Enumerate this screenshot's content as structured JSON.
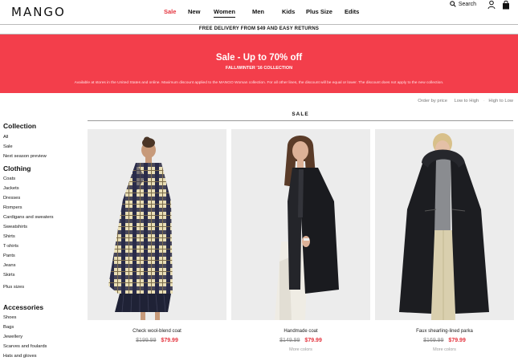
{
  "header": {
    "logo": "MANGO",
    "nav": [
      {
        "label": "Sale",
        "key": "sale"
      },
      {
        "label": "New",
        "key": "new"
      },
      {
        "label": "Women",
        "key": "women"
      },
      {
        "label": "Men",
        "key": "men"
      },
      {
        "label": "Kids",
        "key": "kids"
      },
      {
        "label": "Plus Size",
        "key": "plus-size"
      },
      {
        "label": "Edits",
        "key": "edits"
      }
    ],
    "search_label": "Search"
  },
  "delivery_text": "FREE DELIVERY FROM $49 AND EASY RETURNS",
  "promo": {
    "title": "Sale - Up to 70% off",
    "subtitle": "FALL/WINTER '16 COLLECTION",
    "note": "Available at stores in the United States and online. Maximum discount applied to the MANGO Woman collection. For all other lines, the discount will be equal or lower. The discount does not apply to the new collection.",
    "color": "#f33e4b"
  },
  "order_by": {
    "label": "Order by price",
    "options": [
      "Low to High",
      "High to Low"
    ]
  },
  "section_title": "SALE",
  "sidebar": {
    "collection_heading": "Collection",
    "collection": [
      "All",
      "Sale",
      "Next season preview"
    ],
    "clothing_heading": "Clothing",
    "clothing": [
      "Coats",
      "Jackets",
      "Dresses",
      "Rompers",
      "Cardigans and sweaters",
      "Sweatshirts",
      "Shirts",
      "T-shirts",
      "Pants",
      "Jeans",
      "Skirts"
    ],
    "plus_sizes": "Plus sizes",
    "accessories_heading": "Accessories",
    "accessories": [
      "Shoes",
      "Bags",
      "Jewellery",
      "Scarves and foulards",
      "Hats and gloves"
    ]
  },
  "products": [
    {
      "name": "Check wool-blend coat",
      "old_price": "$199.99",
      "new_price": "$79.99",
      "more": ""
    },
    {
      "name": "Handmade coat",
      "old_price": "$149.99",
      "new_price": "$79.99",
      "more": "More colors"
    },
    {
      "name": "Faux shearling-lined parka",
      "old_price": "$169.99",
      "new_price": "$79.99",
      "more": "More colors"
    }
  ],
  "colors": {
    "accent": "#e4343e",
    "promo": "#f33e4b"
  }
}
